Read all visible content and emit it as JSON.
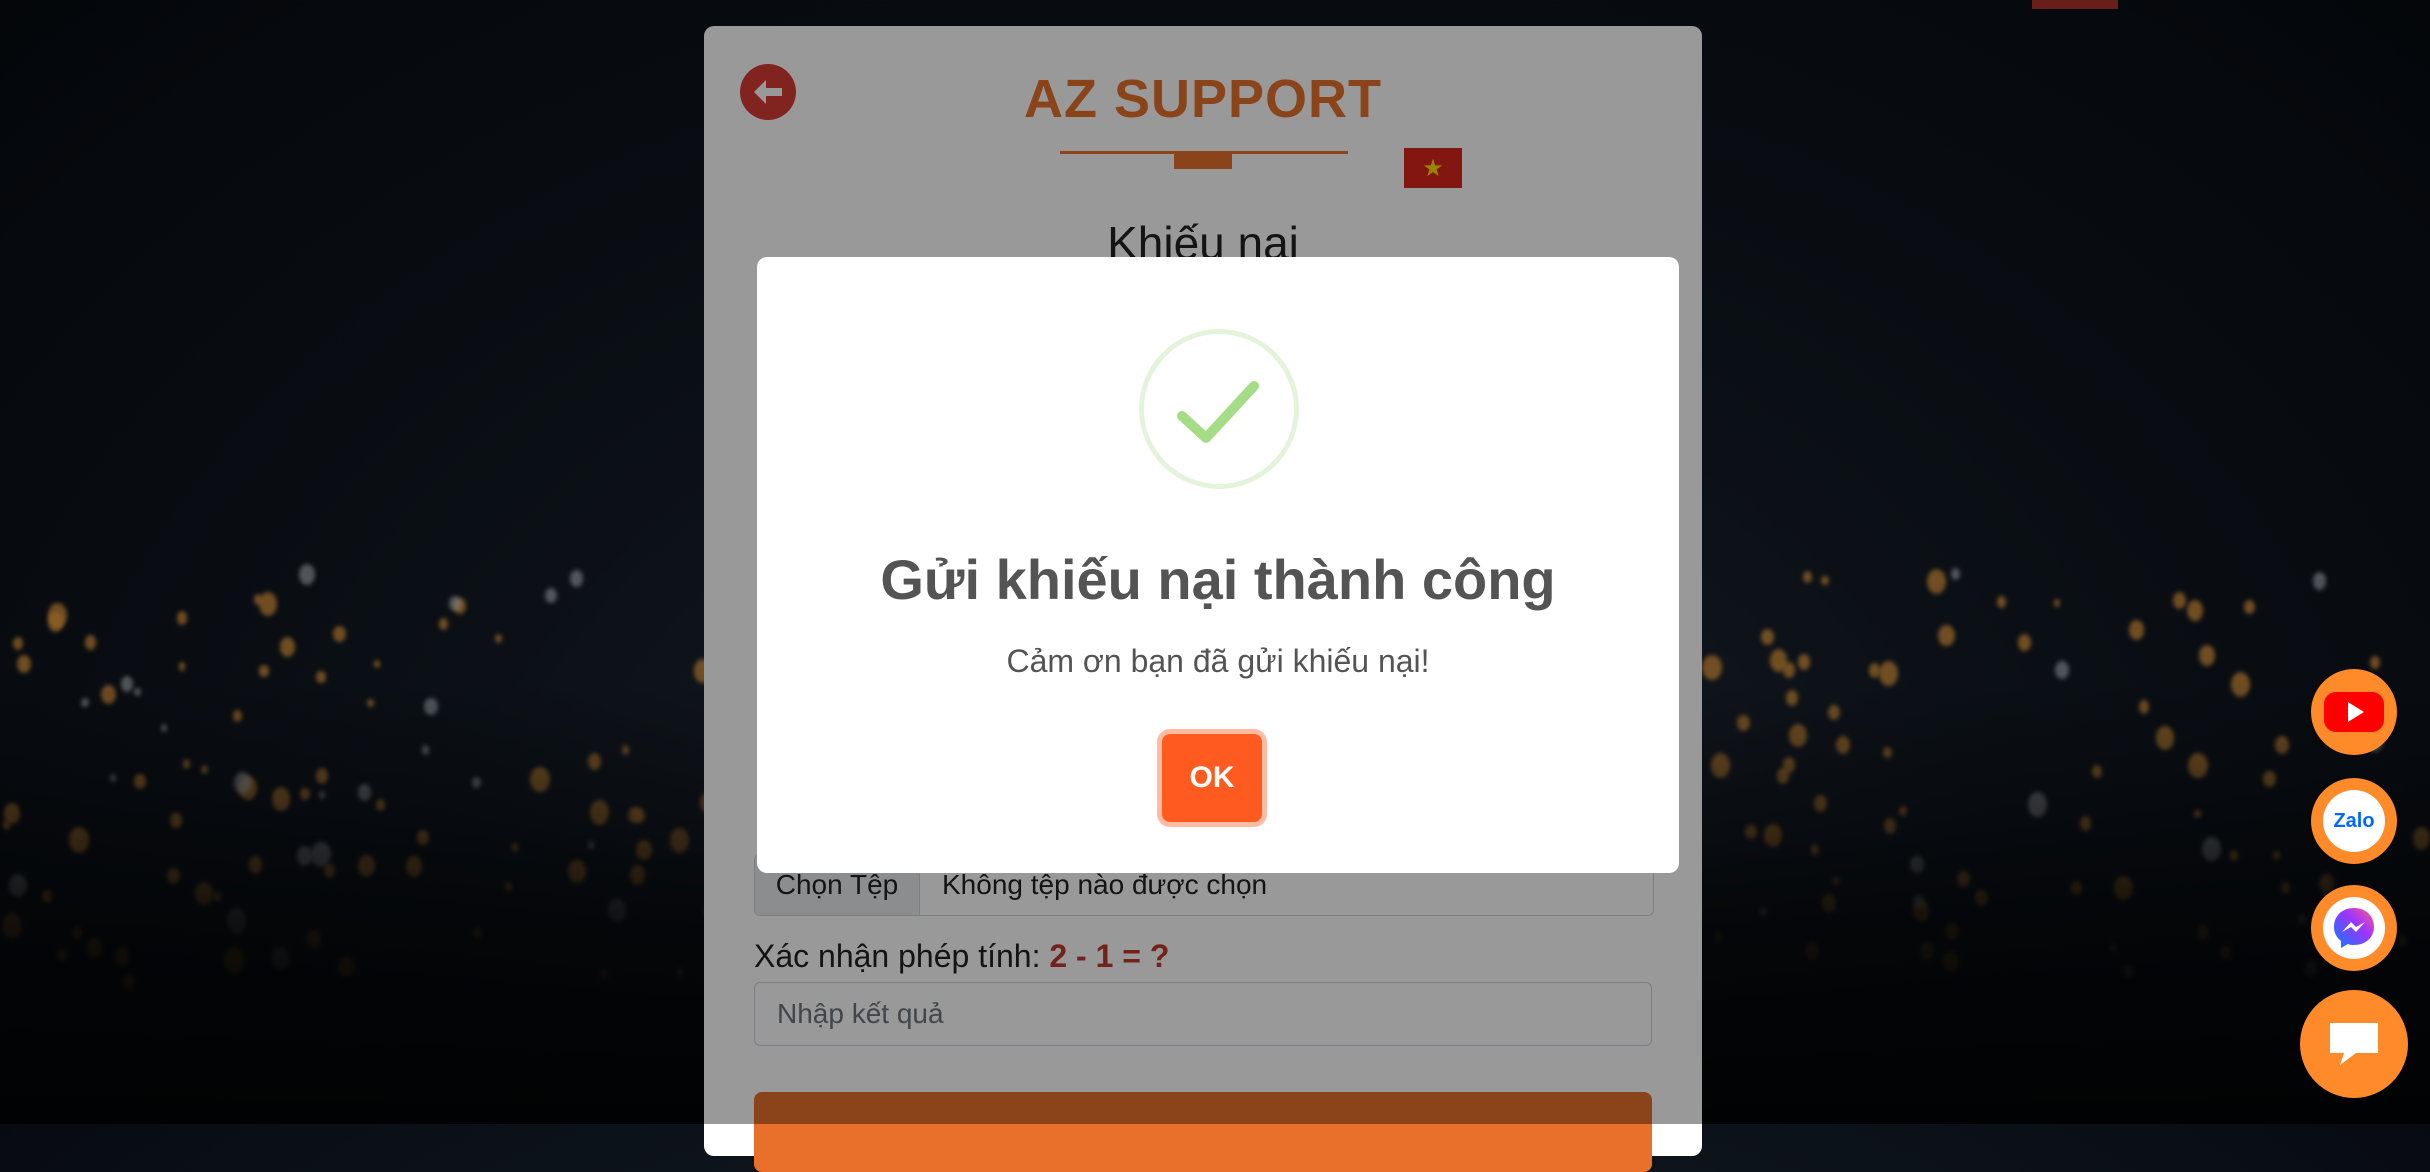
{
  "background": {
    "corner_tab_color": "#b0342a"
  },
  "card": {
    "brand": "AZ SUPPORT",
    "brand_color": "#e8702a",
    "flag": "vietnam-flag-icon",
    "form_title": "Khiếu nại",
    "file_input": {
      "button_label": "Chọn Tệp",
      "status": "Không tệp nào được chọn"
    },
    "captcha": {
      "label": "Xác nhận phép tính:",
      "equation": "2 - 1 = ?",
      "placeholder": "Nhập kết quả"
    }
  },
  "modal": {
    "icon": "success-check-icon",
    "title": "Gửi khiếu nại thành công",
    "message": "Cảm ơn bạn đã gửi khiếu nại!",
    "ok_label": "OK",
    "ok_color": "#ff5a1f"
  },
  "floating": {
    "youtube": "youtube-icon",
    "zalo_label": "Zalo",
    "messenger": "messenger-icon",
    "chat": "chat-icon"
  }
}
